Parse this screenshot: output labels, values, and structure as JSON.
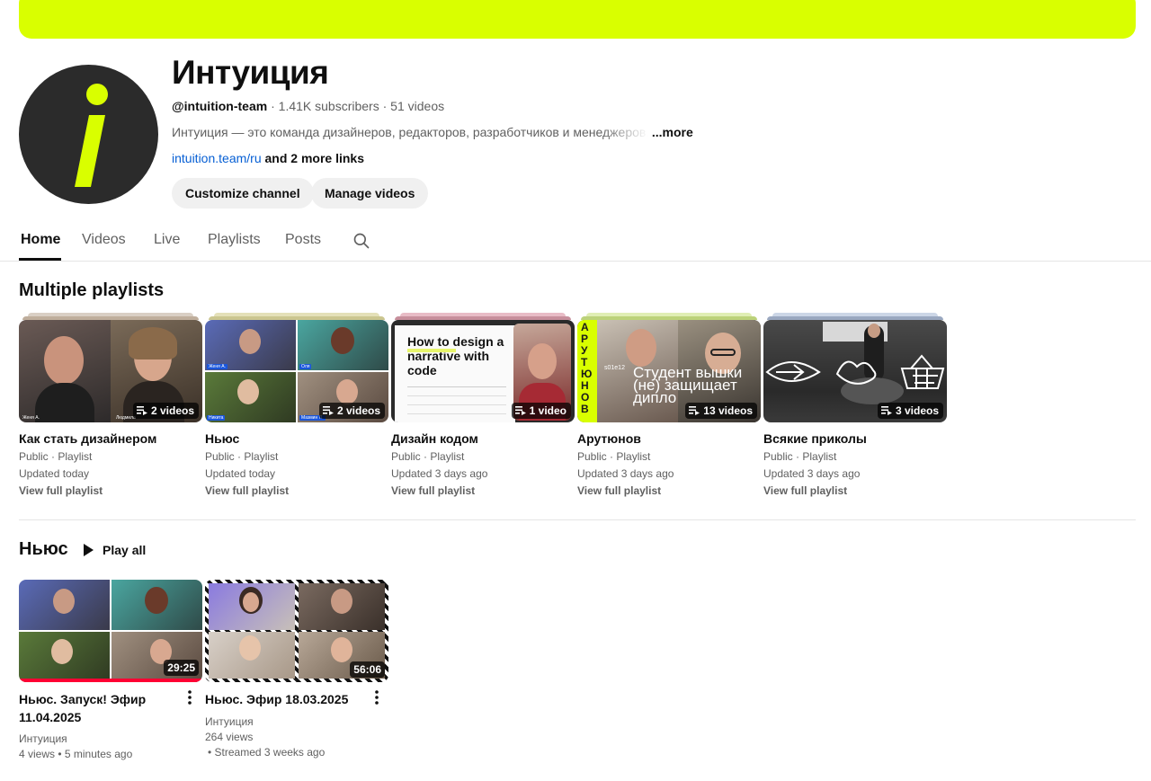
{
  "theme": {
    "banner_color": "#d9ff00",
    "avatar_accent": "#d9ff00",
    "link_color": "#065fd4",
    "progress_color": "#ff0033"
  },
  "channel": {
    "title": "Интуиция",
    "handle": "@intuition-team",
    "subscribers": "1.41K subscribers",
    "videos_count": "51 videos",
    "description": "Интуиция — это команда дизайнеров, редакторов, разработчиков и менеджеров. Д",
    "more_label": "...more",
    "link": "intuition.team/ru",
    "more_links": "and 2 more links",
    "customize_label": "Customize channel",
    "manage_label": "Manage videos"
  },
  "tabs": [
    {
      "label": "Home",
      "active": true
    },
    {
      "label": "Videos",
      "active": false
    },
    {
      "label": "Live",
      "active": false
    },
    {
      "label": "Playlists",
      "active": false
    },
    {
      "label": "Posts",
      "active": false
    }
  ],
  "playlists_section": {
    "title": "Multiple playlists",
    "items": [
      {
        "title": "Как стать дизайнером",
        "count": "2 videos",
        "visibility": "Public · Playlist",
        "updated": "Updated today",
        "view": "View full playlist",
        "stack_color": "#c9b8a8"
      },
      {
        "title": "Ньюс",
        "count": "2 videos",
        "visibility": "Public · Playlist",
        "updated": "Updated today",
        "view": "View full playlist",
        "stack_color": "#d8d4a0"
      },
      {
        "title": "Дизайн кодом",
        "count": "1 video",
        "visibility": "Public · Playlist",
        "updated": "Updated 3 days ago",
        "view": "View full playlist",
        "stack_color": "#d6a4b0"
      },
      {
        "title": "Арутюнов",
        "count": "13 videos",
        "visibility": "Public · Playlist",
        "updated": "Updated 3 days ago",
        "view": "View full playlist",
        "stack_color": "#cfe0a0"
      },
      {
        "title": "Всякие приколы",
        "count": "3 videos",
        "visibility": "Public · Playlist",
        "updated": "Updated 3 days ago",
        "view": "View full playlist",
        "stack_color": "#a8b8d0"
      }
    ],
    "thumb_texts": {
      "p1_name_left": "Женя А.",
      "p1_name_right": "Людмила",
      "p2_names": [
        "Женя А.",
        "Оля",
        "Никита",
        "Мазмин П."
      ],
      "p3_text": "How to design a narrative with code",
      "p4_vertical": "АРУТЮНОВ",
      "p4_episode": "s01e12",
      "p4_overlay": "Студент вышки (не) защищает дипло"
    }
  },
  "news_section": {
    "title": "Ньюс",
    "play_all": "Play all",
    "videos": [
      {
        "title": "Ньюс. Запуск! Эфир 11.04.2025",
        "duration": "29:25",
        "channel": "Интуиция",
        "stats": "4 views • 5 minutes ago",
        "progress": 1.0
      },
      {
        "title": "Ньюс. Эфир 18.03.2025",
        "duration": "56:06",
        "channel": "Интуиция",
        "views": "264 views",
        "streamed": "• Streamed 3 weeks ago",
        "progress": 0
      }
    ]
  }
}
